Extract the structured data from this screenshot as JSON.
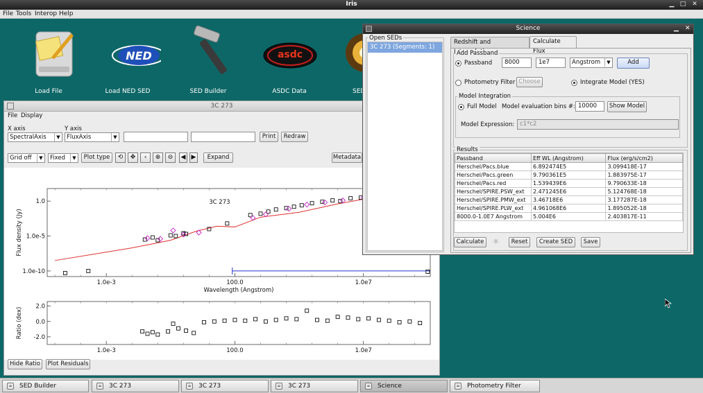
{
  "app": {
    "title": "Iris"
  },
  "menu": [
    "File",
    "Tools",
    "Interop",
    "Help"
  ],
  "desktop": {
    "icons": [
      {
        "label": "Load File",
        "icon": "load-file-icon"
      },
      {
        "label": "Load NED SED",
        "icon": "ned-icon",
        "badge": "NED"
      },
      {
        "label": "SED Builder",
        "icon": "hammer-icon"
      },
      {
        "label": "ASDC Data",
        "icon": "asdc-icon",
        "badge": "asdc"
      },
      {
        "label": "SED",
        "icon": "sed-analyzer-icon"
      }
    ]
  },
  "sed_window": {
    "title": "3C 273",
    "menu": [
      "File",
      "Display"
    ],
    "x_axis_label": "X axis",
    "y_axis_label": "Y axis",
    "x_axis_value": "SpectralAxis",
    "y_axis_value": "FluxAxis",
    "print_label": "Print",
    "redraw_label": "Redraw",
    "grid_value": "Grid off",
    "fixed_value": "Fixed",
    "plot_type_label": "Plot type",
    "expand_label": "Expand",
    "metadata_label": "Metadata",
    "hide_ratio_label": "Hide Ratio",
    "plot_residuals_label": "Plot Residuals",
    "tool_icons": [
      "zoom-fit-icon",
      "recenter-icon",
      "pan-icon",
      "zoom-in-icon",
      "zoom-out-icon",
      "prev-icon",
      "next-icon"
    ]
  },
  "chart_data": [
    {
      "type": "scatter",
      "title": "3C 273",
      "xlabel": "Wavelength (Angstrom)",
      "ylabel": "Flux density (Jy)",
      "xscale": "log",
      "yscale": "log",
      "xticks": [
        "1.0e-3",
        "100.0",
        "1.0e7"
      ],
      "yticks": [
        "1.0",
        "1.0e-5",
        "1.0e-10"
      ],
      "xlim_log10": [
        -5.3,
        9.6
      ],
      "ylim_log10": [
        -10.8,
        1.8
      ],
      "series": [
        {
          "name": "model",
          "kind": "line",
          "color": "#e03030",
          "x_log10": [
            -5.0,
            -2.0,
            -0.5,
            0.5,
            1.3,
            2.0,
            3.0,
            4.5,
            6.0,
            7.5,
            9.0
          ],
          "y_log10": [
            -8.5,
            -6.7,
            -5.6,
            -4.3,
            -3.6,
            -3.7,
            -2.3,
            -1.6,
            -0.4,
            0.6,
            1.3
          ]
        },
        {
          "name": "data",
          "kind": "squares",
          "color": "#111111",
          "x_log10": [
            -5.2,
            -4.6,
            -3.7,
            -1.5,
            -1.2,
            -1.0,
            -0.5,
            -0.3,
            0.0,
            0.1,
            1.0,
            1.7,
            2.6,
            3.0,
            3.3,
            3.6,
            4.0,
            4.3,
            4.6,
            5.0,
            5.4,
            5.8,
            6.1,
            6.5,
            6.9,
            7.2,
            7.6,
            8.0,
            8.4,
            8.8,
            9.1,
            9.5
          ],
          "y_log10": [
            -11.0,
            -10.3,
            -10.0,
            -5.5,
            -5.2,
            -5.6,
            -4.9,
            -5.0,
            -4.6,
            -4.7,
            -4.0,
            -3.2,
            -2.0,
            -1.8,
            -1.5,
            -1.2,
            -1.0,
            -0.8,
            -0.6,
            -0.3,
            -0.1,
            0.1,
            0.0,
            0.4,
            0.5,
            0.6,
            0.9,
            1.0,
            1.1,
            1.2,
            1.2,
            -10.1
          ]
        },
        {
          "name": "data-alt",
          "kind": "diamonds",
          "color": "#c026c0",
          "x_log10": [
            -1.4,
            -0.9,
            -0.4,
            0.0,
            0.6,
            2.7,
            3.2,
            4.1,
            4.8,
            5.5,
            6.2,
            7.0,
            7.8,
            8.6
          ],
          "y_log10": [
            -5.3,
            -5.4,
            -4.2,
            -4.8,
            -4.5,
            -2.4,
            -1.9,
            -1.1,
            -0.5,
            -0.2,
            0.1,
            0.5,
            0.8,
            1.1
          ]
        }
      ],
      "passband_line": {
        "x_log10": [
          1.9,
          9.6
        ],
        "y_log10": -10.0,
        "color": "#2233cc"
      }
    },
    {
      "type": "scatter",
      "xlabel": "",
      "ylabel": "Ratio (dex)",
      "xscale": "log",
      "xticks": [
        "1.0e-3",
        "100.0",
        "1.0e7"
      ],
      "yticks": [
        "2.0",
        "0.0",
        "-2.0"
      ],
      "ylim": [
        -3.0,
        2.6
      ],
      "xlim_log10": [
        -5.3,
        9.6
      ],
      "series": [
        {
          "name": "ratio",
          "kind": "squares",
          "color": "#111111",
          "x_log10": [
            -1.6,
            -1.4,
            -1.2,
            -1.0,
            -0.6,
            -0.4,
            -0.2,
            0.1,
            0.4,
            0.8,
            1.2,
            1.6,
            2.0,
            2.4,
            2.8,
            3.2,
            3.6,
            4.0,
            4.4,
            4.8,
            5.2,
            5.6,
            6.0,
            6.4,
            6.8,
            7.2,
            7.6,
            8.0,
            8.4,
            8.8,
            9.2
          ],
          "y_log10": [
            -1.3,
            -1.6,
            -1.4,
            -1.7,
            -1.3,
            -0.3,
            -0.9,
            -1.2,
            -1.5,
            -0.1,
            0.0,
            0.1,
            0.2,
            0.1,
            0.3,
            0.0,
            0.2,
            0.4,
            0.3,
            1.4,
            0.2,
            0.1,
            0.6,
            0.5,
            0.3,
            0.4,
            0.2,
            0.1,
            -0.1,
            0.0,
            -0.2
          ]
        }
      ]
    }
  ],
  "science": {
    "title": "Science",
    "open_seds_label": "Open SEDs",
    "sed_list": [
      "3C 273 (Segments: 1)"
    ],
    "tabs": [
      "Redshift and Interpolation",
      "Calculate Flux"
    ],
    "active_tab": "Calculate Flux",
    "add_passband_label": "Add Passband",
    "passband_label": "Passband",
    "passband_min": "8000",
    "passband_max": "1e7",
    "unit_value": "Angstrom",
    "add_label": "Add",
    "photometry_filter_label": "Photometry Filter",
    "choose_label": "Choose",
    "integrate_model_label": "Integrate Model (YES)",
    "model_integration_label": "Model Integration",
    "full_model_label": "Full Model",
    "model_bins_label": "Model evaluation bins #:",
    "model_bins_value": "10000",
    "show_model_label": "Show Model",
    "model_expression_label": "Model Expression:",
    "model_expression_value": "c1*c2",
    "results_label": "Results",
    "columns": [
      "Passband",
      "Eff WL (Angstrom)",
      "Flux (erg/s/cm2)"
    ],
    "rows": [
      [
        "Herschel/Pacs.blue",
        "6.892474E5",
        "3.099418E-17"
      ],
      [
        "Herschel/Pacs.green",
        "9.790361E5",
        "1.883975E-17"
      ],
      [
        "Herschel/Pacs.red",
        "1.539439E6",
        "9.790633E-18"
      ],
      [
        "Herschel/SPIRE.PSW_ext",
        "2.471245E6",
        "5.124768E-18"
      ],
      [
        "Herschel/SPIRE.PMW_ext",
        "3.46718E6",
        "3.177287E-18"
      ],
      [
        "Herschel/SPIRE.PLW_ext",
        "4.961068E6",
        "1.895052E-18"
      ],
      [
        "8000.0-1.0E7 Angstrom",
        "5.004E6",
        "2.403817E-11"
      ]
    ],
    "calculate_label": "Calculate",
    "reset_label": "Reset",
    "create_sed_label": "Create SED",
    "save_label": "Save"
  },
  "taskbar": [
    "SED Builder",
    "3C 273",
    "3C 273",
    "3C 273",
    "Science",
    "Photometry Filter Selector"
  ],
  "taskbar_active": 4,
  "colors": {
    "desktop": "#0e6767",
    "model_line": "#e03030",
    "passband_line": "#2233cc",
    "selection": "#7ea6df"
  }
}
